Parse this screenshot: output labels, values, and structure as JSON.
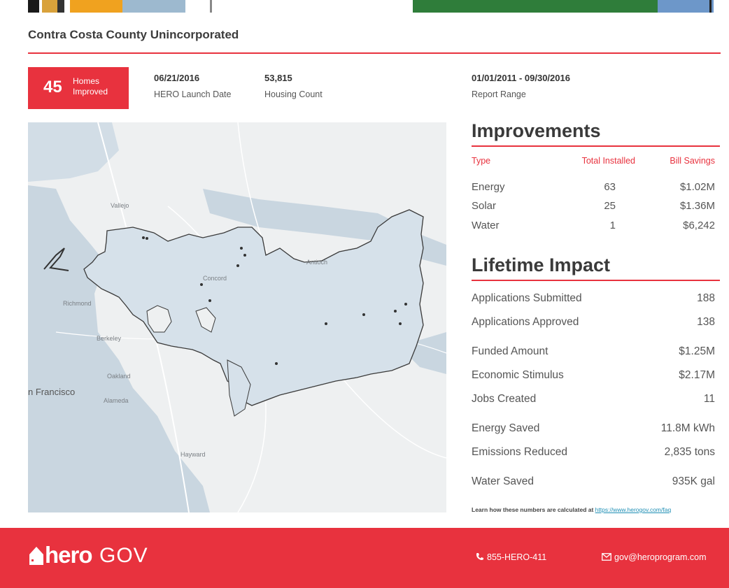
{
  "header": {
    "county": "Contra Costa County Unincorporated"
  },
  "homes": {
    "count": "45",
    "label": "Homes Improved"
  },
  "stats": [
    {
      "value": "06/21/2016",
      "label": "HERO Launch Date"
    },
    {
      "value": "53,815",
      "label": "Housing Count"
    },
    {
      "value": "01/01/2011 - 09/30/2016",
      "label": "Report Range"
    }
  ],
  "map": {
    "places": [
      "Vallejo",
      "Concord",
      "Antioch",
      "Richmond",
      "Berkeley",
      "Oakland",
      "n Francisco",
      "Alameda",
      "Hayward"
    ]
  },
  "improvements": {
    "title": "Improvements",
    "columns": [
      "Type",
      "Total Installed",
      "Bill Savings"
    ],
    "rows": [
      {
        "type": "Energy",
        "installed": "63",
        "savings": "$1.02M"
      },
      {
        "type": "Solar",
        "installed": "25",
        "savings": "$1.36M"
      },
      {
        "type": "Water",
        "installed": "1",
        "savings": "$6,242"
      }
    ]
  },
  "lifetime": {
    "title": "Lifetime Impact",
    "rows": [
      {
        "label": "Applications Submitted",
        "value": "188"
      },
      {
        "label": "Applications Approved",
        "value": "138"
      },
      {
        "label": "Funded Amount",
        "value": "$1.25M"
      },
      {
        "label": "Economic Stimulus",
        "value": "$2.17M"
      },
      {
        "label": "Jobs Created",
        "value": "11"
      },
      {
        "label": "Energy Saved",
        "value": "11.8M kWh"
      },
      {
        "label": "Emissions Reduced",
        "value": "2,835 tons"
      },
      {
        "label": "Water Saved",
        "value": "935K gal"
      }
    ]
  },
  "learn": {
    "text": "Learn how these numbers are calculated at ",
    "link": "https://www.herogov.com/faq"
  },
  "footer": {
    "logo_hero": "hero",
    "logo_gov": "GOV",
    "phone": "855-HERO-411",
    "email": "gov@heroprogram.com"
  },
  "colors": {
    "accent": "#e8323e",
    "water": "#c9d6e0",
    "land": "#eef0f1",
    "region": "#d6e1ea"
  },
  "icons": [
    "house-icon",
    "phone-icon",
    "mail-icon"
  ]
}
